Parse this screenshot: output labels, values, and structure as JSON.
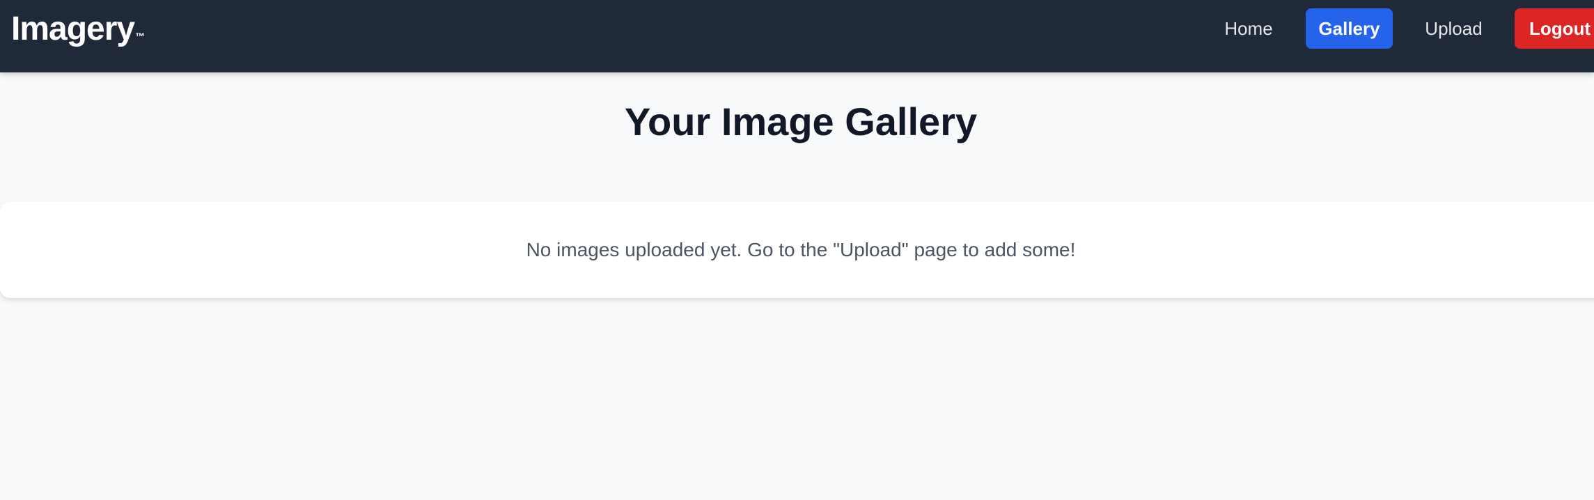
{
  "nav": {
    "brand": "Imagery",
    "brand_mark": "™",
    "links": [
      {
        "label": "Home",
        "active": false
      },
      {
        "label": "Gallery",
        "active": true
      },
      {
        "label": "Upload",
        "active": false
      },
      {
        "label": "Logout",
        "active": false
      }
    ]
  },
  "main": {
    "title": "Your Image Gallery",
    "empty_message": "No images uploaded yet. Go to the \"Upload\" page to add some!"
  },
  "colors": {
    "navbar_bg": "#1f2937",
    "page_bg": "#f8f9fb",
    "active_link_bg": "#2563eb",
    "logout_bg": "#dc2626",
    "title_text": "#111827",
    "message_text": "#4b5563"
  }
}
